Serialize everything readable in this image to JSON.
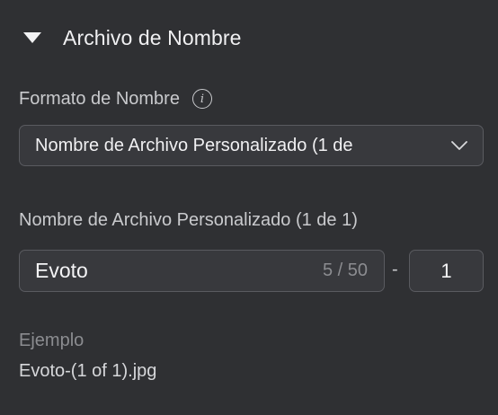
{
  "section": {
    "title": "Archivo de Nombre",
    "icon": "caret-down-icon"
  },
  "format": {
    "label": "Formato de Nombre",
    "info_icon": "info-icon",
    "info_glyph": "i",
    "selected": "Nombre de Archivo Personalizado (1 de"
  },
  "custom_name": {
    "label": "Nombre de Archivo Personalizado (1 de 1)",
    "value": "Evoto",
    "counter": "5 / 50",
    "separator": "-",
    "sequence": "1"
  },
  "example": {
    "label": "Ejemplo",
    "value": "Evoto-(1 of 1).jpg"
  },
  "colors": {
    "background": "#2f3033",
    "field_bg": "#38393d",
    "border": "#5a5b60",
    "text": "#f0f0f2",
    "muted": "#8b8c90"
  }
}
